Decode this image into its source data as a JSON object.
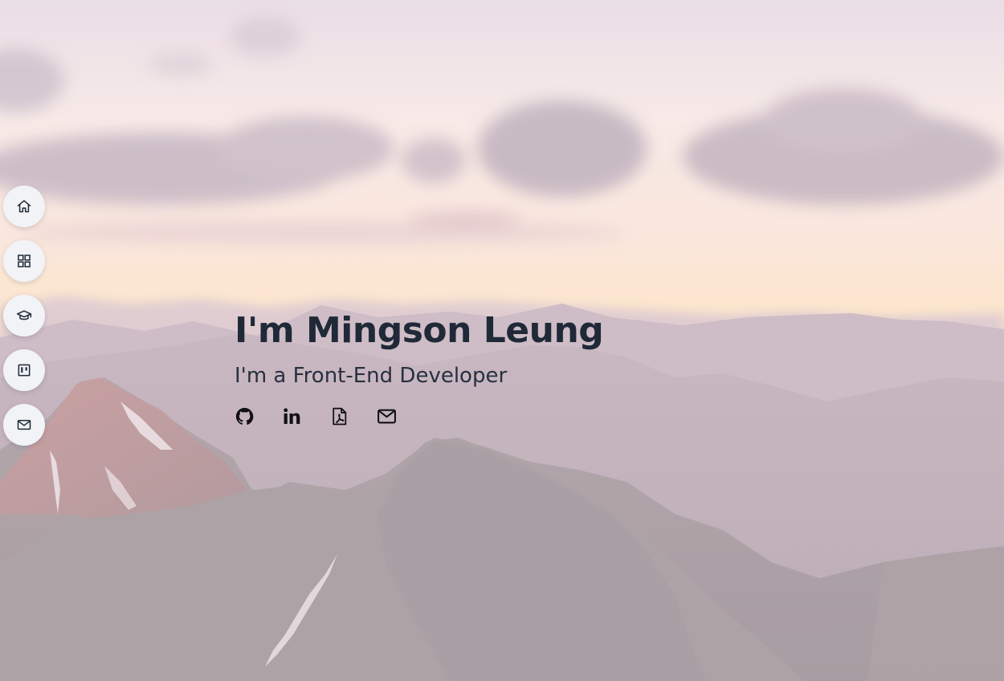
{
  "hero": {
    "title": "I'm Mingson Leung",
    "subtitle": "I'm a Front-End Developer"
  },
  "side_nav": {
    "items": [
      {
        "icon": "home-icon"
      },
      {
        "icon": "grid-icon"
      },
      {
        "icon": "graduation-cap-icon"
      },
      {
        "icon": "board-icon"
      },
      {
        "icon": "mail-icon"
      }
    ]
  },
  "socials": [
    {
      "icon": "github-icon"
    },
    {
      "icon": "linkedin-icon"
    },
    {
      "icon": "pdf-icon"
    },
    {
      "icon": "envelope-icon"
    }
  ],
  "colors": {
    "text": "#1f2937",
    "nav_button": "#f1f3f6",
    "sky_top": "#e9dde6",
    "sky_horizon": "#fde8c6",
    "mountains": "#a79a9e"
  }
}
